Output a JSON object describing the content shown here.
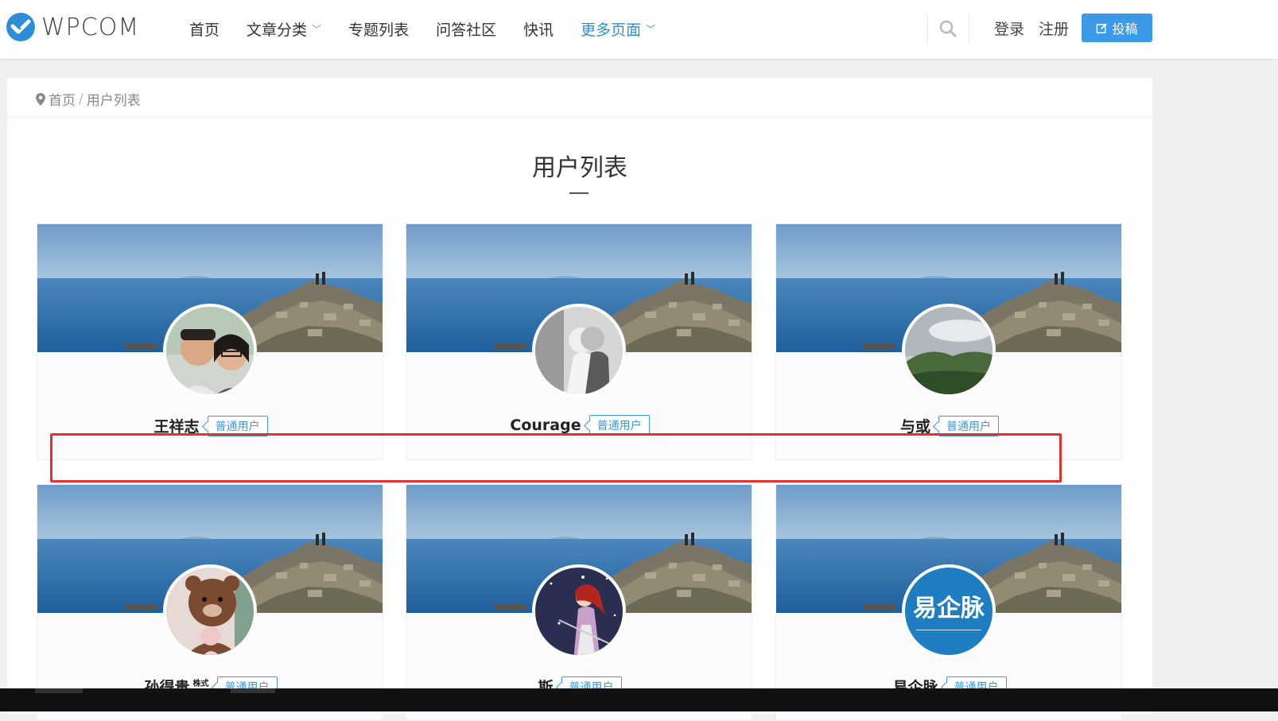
{
  "header": {
    "logo_text": "WPCOM",
    "nav": [
      {
        "label": "首页",
        "has_dropdown": false,
        "active": false
      },
      {
        "label": "文章分类",
        "has_dropdown": true,
        "active": false
      },
      {
        "label": "专题列表",
        "has_dropdown": false,
        "active": false
      },
      {
        "label": "问答社区",
        "has_dropdown": false,
        "active": false
      },
      {
        "label": "快讯",
        "has_dropdown": false,
        "active": false
      },
      {
        "label": "更多页面",
        "has_dropdown": true,
        "active": true
      }
    ],
    "login_label": "登录",
    "register_label": "注册",
    "post_label": "投稿"
  },
  "breadcrumb": {
    "home": "首页",
    "separator": "/",
    "current": "用户列表"
  },
  "page_title": "用户列表",
  "users": [
    {
      "name": "王祥志",
      "tag": "普通用户",
      "avatar": "couple-photo"
    },
    {
      "name": "Courage",
      "tag": "普通用户",
      "avatar": "bw-kids-photo"
    },
    {
      "name": "与或",
      "tag": "普通用户",
      "avatar": "landscape-photo"
    },
    {
      "name": "孙得贵",
      "tag": "普通用户",
      "avatar": "bear-photo",
      "badge": "株式"
    },
    {
      "name": "斯",
      "tag": "普通用户",
      "avatar": "anime-photo"
    },
    {
      "name": "易企脉",
      "tag": "普通用户",
      "avatar": "yiqimai-logo",
      "avatar_text": "易企脉"
    }
  ],
  "colors": {
    "accent": "#3a9ae8",
    "highlight": "#e53030"
  }
}
